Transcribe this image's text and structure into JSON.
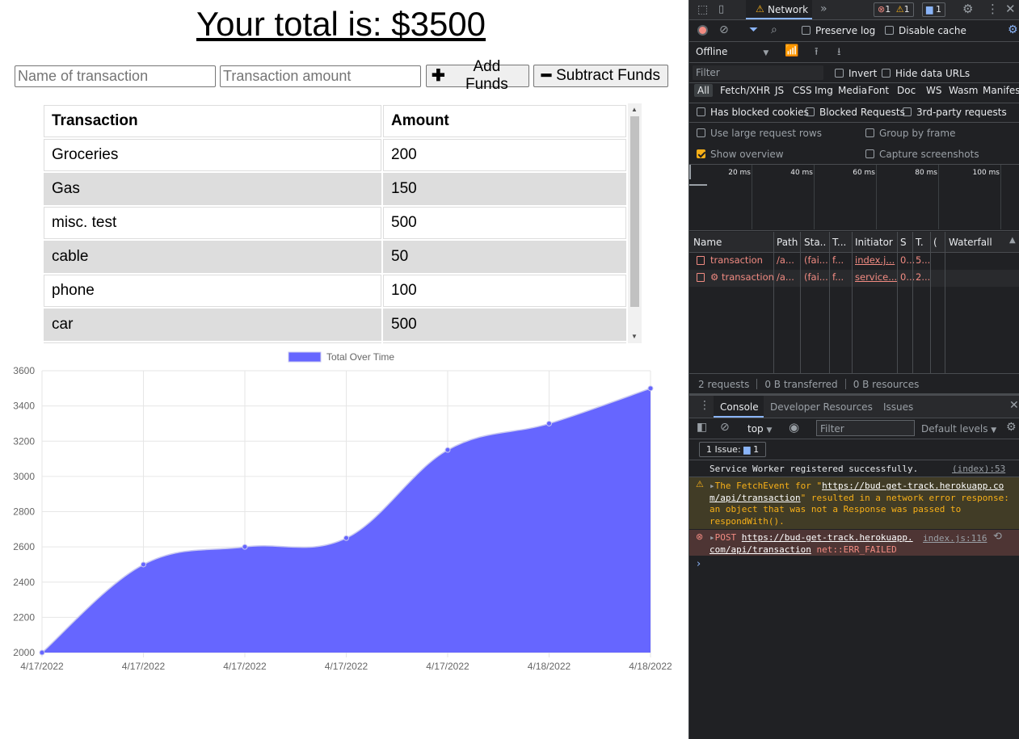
{
  "app": {
    "total_text": "Your total is: $3500",
    "name_placeholder": "Name of transaction",
    "amount_placeholder": "Transaction amount",
    "add_button": "Add Funds",
    "subtract_button": "Subtract Funds",
    "table": {
      "headers": [
        "Transaction",
        "Amount"
      ],
      "rows": [
        {
          "name": "Groceries",
          "amount": "200"
        },
        {
          "name": "Gas",
          "amount": "150"
        },
        {
          "name": "misc. test",
          "amount": "500"
        },
        {
          "name": "cable",
          "amount": "50"
        },
        {
          "name": "phone",
          "amount": "100"
        },
        {
          "name": "car",
          "amount": "500"
        }
      ]
    }
  },
  "chart_data": {
    "type": "area",
    "title": "",
    "legend_position": "top",
    "grid": true,
    "fill_color": "#6666ff",
    "x": [
      "4/17/2022",
      "4/17/2022",
      "4/17/2022",
      "4/17/2022",
      "4/17/2022",
      "4/18/2022",
      "4/18/2022"
    ],
    "series": [
      {
        "name": "Total Over Time",
        "values": [
          2000,
          2500,
          2600,
          2650,
          3150,
          3300,
          3500
        ]
      }
    ],
    "ylim": [
      2000,
      3600
    ],
    "yticks": [
      2000,
      2200,
      2400,
      2600,
      2800,
      3000,
      3200,
      3400,
      3600
    ]
  },
  "devtools": {
    "active_tab": "Network",
    "error_count": "1",
    "warning_count": "1",
    "issue_count": "1",
    "preserve_log": "Preserve log",
    "disable_cache": "Disable cache",
    "throttle": "Offline",
    "filter_placeholder": "Filter",
    "invert": "Invert",
    "hide_data_urls": "Hide data URLs",
    "types": [
      "All",
      "Fetch/XHR",
      "JS",
      "CSS",
      "Img",
      "Media",
      "Font",
      "Doc",
      "WS",
      "Wasm",
      "Manifest"
    ],
    "has_blocked_cookies": "Has blocked cookies",
    "blocked_requests": "Blocked Requests",
    "third_party": "3rd-party requests",
    "large_rows": "Use large request rows",
    "group_by_frame": "Group by frame",
    "show_overview": "Show overview",
    "capture_screenshots": "Capture screenshots",
    "timeline_ticks": [
      "20 ms",
      "40 ms",
      "60 ms",
      "80 ms",
      "100 ms"
    ],
    "columns": [
      "Name",
      "Path",
      "Sta..",
      "T...",
      "Initiator",
      "S",
      "T.",
      "(",
      "Waterfall"
    ],
    "requests": [
      {
        "name": "transaction",
        "path": "/a...",
        "status": "(fai...",
        "type": "f...",
        "initiator": "index.j...",
        "size": "0...",
        "time": "5..."
      },
      {
        "name": "⚙ transaction",
        "path": "/a...",
        "status": "(fai...",
        "type": "f...",
        "initiator": "service...",
        "size": "0...",
        "time": "2..."
      }
    ],
    "summary": [
      "2 requests",
      "0 B transferred",
      "0 B resources"
    ],
    "drawer_tabs": [
      "Console",
      "Developer Resources",
      "Issues"
    ],
    "context": "top",
    "console_filter": "Filter",
    "levels": "Default levels",
    "issues_badge": "1 Issue:",
    "issues_badge_count": "1",
    "messages": {
      "info_text": "Service Worker registered successfully.",
      "info_source": "(index):53",
      "warn_line1_pre": "The FetchEvent for \"",
      "warn_url1": "https://bud-get-track.herokuapp.co",
      "warn_url2": "m/api/transaction",
      "warn_line2_post": "\" resulted in a network error response:",
      "warn_line3": "an object that was not a Response was passed to",
      "warn_line4": "respondWith().",
      "err_method": "POST",
      "err_url1": "https://bud-get-track.herokuapp.",
      "err_url2": "com/api/transaction",
      "err_tail": "net::ERR_FAILED",
      "err_source": "index.js:116"
    }
  }
}
